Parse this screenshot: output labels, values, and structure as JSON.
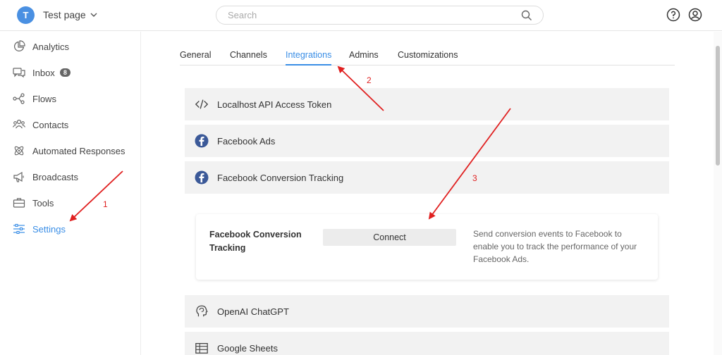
{
  "header": {
    "avatar_letter": "T",
    "page_name": "Test page",
    "search_placeholder": "Search"
  },
  "sidebar": {
    "items": [
      {
        "label": "Analytics",
        "icon": "chart-pie-icon"
      },
      {
        "label": "Inbox",
        "icon": "chat-bubbles-icon",
        "badge": "8"
      },
      {
        "label": "Flows",
        "icon": "flow-nodes-icon"
      },
      {
        "label": "Contacts",
        "icon": "people-icon"
      },
      {
        "label": "Automated Responses",
        "icon": "atom-icon"
      },
      {
        "label": "Broadcasts",
        "icon": "megaphone-icon"
      },
      {
        "label": "Tools",
        "icon": "toolbox-icon"
      },
      {
        "label": "Settings",
        "icon": "sliders-icon",
        "active": true
      }
    ]
  },
  "tabs": [
    {
      "label": "General"
    },
    {
      "label": "Channels"
    },
    {
      "label": "Integrations",
      "active": true
    },
    {
      "label": "Admins"
    },
    {
      "label": "Customizations"
    }
  ],
  "integrations": [
    {
      "label": "Localhost API Access Token",
      "icon": "code-icon"
    },
    {
      "label": "Facebook Ads",
      "icon": "facebook-icon"
    },
    {
      "label": "Facebook Conversion Tracking",
      "icon": "facebook-icon"
    },
    {
      "label": "OpenAI ChatGPT",
      "icon": "brain-head-icon"
    },
    {
      "label": "Google Sheets",
      "icon": "table-icon"
    }
  ],
  "card": {
    "title": "Facebook Conversion Tracking",
    "button_label": "Connect",
    "description": "Send conversion events to Facebook to enable you to track the performance of your Facebook Ads."
  },
  "annotations": [
    "1",
    "2",
    "3"
  ],
  "colors": {
    "accent": "#3a8ee6",
    "facebook": "#3b5998",
    "annotation": "#e02020"
  }
}
